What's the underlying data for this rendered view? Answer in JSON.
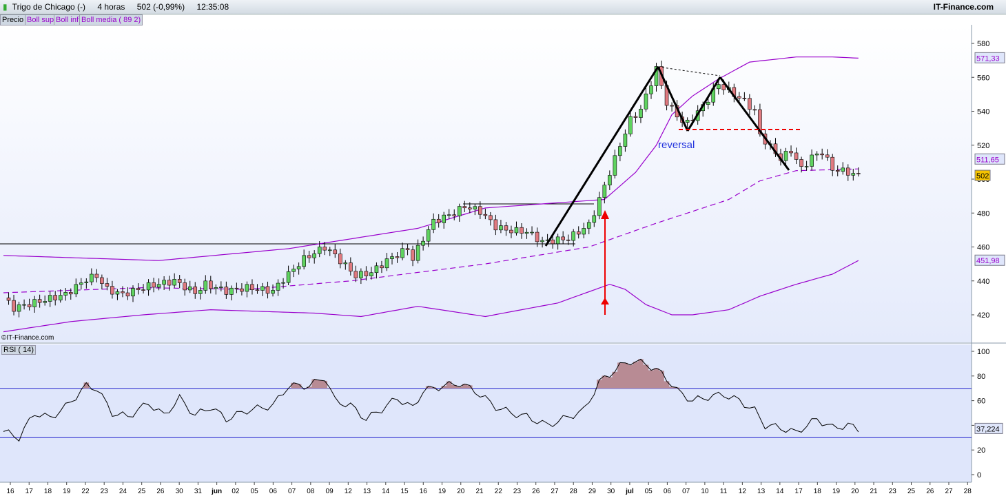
{
  "header": {
    "instrument": "Trigo de Chicago (-)",
    "period": "4 horas",
    "quote": "502 (-0,99%)",
    "time": "12:35:08",
    "brand": "IT-Finance.com"
  },
  "legend": {
    "precio": "Precio",
    "boll_sup": "Boll sup",
    "boll_inf": "Boll inf",
    "boll_media": "Boll media ( 89 2)"
  },
  "watermark": "©IT-Finance.com",
  "annotation": "reversal",
  "rsi_label": "RSI ( 14)",
  "colors": {
    "up": "#5fd35f",
    "down": "#e07a80",
    "boll": "#9900cc",
    "rsi_fill": "#b88b94"
  },
  "chart_data": [
    {
      "type": "candlestick",
      "title": "Trigo de Chicago 4 horas",
      "ylim": [
        410,
        590
      ],
      "yticks": [
        580,
        560,
        540,
        520,
        500,
        480,
        460,
        440,
        420
      ],
      "price_tags": {
        "boll_sup": "571,33",
        "boll_media": "511,65",
        "last": "502",
        "boll_inf": "451,98"
      },
      "x_labels": [
        "16",
        "17",
        "18",
        "19",
        "22",
        "23",
        "24",
        "25",
        "26",
        "30",
        "31",
        "jun",
        "02",
        "05",
        "06",
        "07",
        "08",
        "09",
        "12",
        "13",
        "14",
        "15",
        "16",
        "19",
        "20",
        "21",
        "22",
        "23",
        "26",
        "27",
        "28",
        "29",
        "30",
        "jul",
        "05",
        "06",
        "07",
        "10",
        "11",
        "12",
        "13",
        "14",
        "17",
        "18",
        "19",
        "20",
        "21",
        "23",
        "25",
        "26",
        "27",
        "28"
      ],
      "close_waypoints": [
        [
          0,
          430
        ],
        [
          2,
          424
        ],
        [
          7,
          428
        ],
        [
          12,
          432
        ],
        [
          16,
          441
        ],
        [
          18,
          443
        ],
        [
          20,
          435
        ],
        [
          23,
          432
        ],
        [
          28,
          437
        ],
        [
          33,
          440
        ],
        [
          37,
          433
        ],
        [
          39,
          438
        ],
        [
          43,
          434
        ],
        [
          47,
          436
        ],
        [
          52,
          434
        ],
        [
          54,
          441
        ],
        [
          58,
          453
        ],
        [
          62,
          460
        ],
        [
          64,
          455
        ],
        [
          68,
          443
        ],
        [
          71,
          445
        ],
        [
          74,
          452
        ],
        [
          78,
          459
        ],
        [
          79,
          453
        ],
        [
          81,
          465
        ],
        [
          83,
          475
        ],
        [
          87,
          480
        ],
        [
          89,
          484
        ],
        [
          92,
          481
        ],
        [
          95,
          472
        ],
        [
          97,
          470
        ],
        [
          101,
          469
        ],
        [
          104,
          463
        ],
        [
          109,
          465
        ],
        [
          113,
          473
        ],
        [
          115,
          488
        ],
        [
          117,
          504
        ],
        [
          119,
          520
        ],
        [
          121,
          535
        ],
        [
          123,
          541
        ],
        [
          126,
          565
        ],
        [
          128,
          545
        ],
        [
          131,
          534
        ],
        [
          132,
          533
        ],
        [
          135,
          543
        ],
        [
          138,
          556
        ],
        [
          143,
          546
        ],
        [
          145,
          540
        ],
        [
          146,
          526
        ],
        [
          150,
          512
        ],
        [
          152,
          517
        ],
        [
          154,
          506
        ],
        [
          156,
          513
        ],
        [
          158,
          516
        ],
        [
          160,
          506
        ],
        [
          163,
          504
        ],
        [
          165,
          502
        ]
      ],
      "boll_sup": [
        [
          0,
          455
        ],
        [
          30,
          452
        ],
        [
          55,
          459
        ],
        [
          80,
          471
        ],
        [
          93,
          483
        ],
        [
          116,
          488
        ],
        [
          122,
          504
        ],
        [
          126,
          520
        ],
        [
          129,
          538
        ],
        [
          133,
          549
        ],
        [
          138,
          559
        ],
        [
          144,
          569
        ],
        [
          153,
          572
        ],
        [
          160,
          572
        ],
        [
          165,
          571.3
        ]
      ],
      "boll_inf": [
        [
          0,
          410
        ],
        [
          13,
          416
        ],
        [
          27,
          420
        ],
        [
          40,
          423
        ],
        [
          60,
          421
        ],
        [
          69,
          419
        ],
        [
          80,
          425
        ],
        [
          93,
          419
        ],
        [
          107,
          427
        ],
        [
          117,
          438
        ],
        [
          120,
          435
        ],
        [
          124,
          426
        ],
        [
          129,
          420
        ],
        [
          133,
          420
        ],
        [
          140,
          423
        ],
        [
          146,
          431
        ],
        [
          153,
          438
        ],
        [
          160,
          444
        ],
        [
          165,
          452
        ]
      ],
      "boll_media": [
        [
          0,
          433
        ],
        [
          27,
          436
        ],
        [
          47,
          435
        ],
        [
          67,
          440
        ],
        [
          93,
          450
        ],
        [
          113,
          460
        ],
        [
          126,
          474
        ],
        [
          140,
          488
        ],
        [
          146,
          499
        ],
        [
          153,
          505
        ],
        [
          165,
          506
        ]
      ],
      "annotation_lines": [
        [
          [
            26.8,
            461
          ],
          [
            5.5,
            567
          ]
        ],
        [
          [
            5.5,
            567
          ],
          [
            7.3,
            529
          ]
        ],
        [
          [
            7.3,
            529
          ],
          [
            11.2,
            560
          ]
        ],
        [
          [
            11.2,
            560
          ],
          [
            14.8,
            505
          ]
        ]
      ]
    },
    {
      "type": "line",
      "title": "RSI ( 14)",
      "ylim": [
        0,
        100
      ],
      "yticks": [
        100,
        80,
        60,
        40,
        20,
        0
      ],
      "levels": [
        70,
        30
      ],
      "last": "37,224",
      "values_waypoints": [
        [
          0,
          35
        ],
        [
          3,
          30
        ],
        [
          6,
          50
        ],
        [
          9,
          46
        ],
        [
          12,
          55
        ],
        [
          16,
          72
        ],
        [
          18,
          70
        ],
        [
          21,
          50
        ],
        [
          24,
          47
        ],
        [
          28,
          58
        ],
        [
          31,
          48
        ],
        [
          34,
          62
        ],
        [
          37,
          48
        ],
        [
          40,
          55
        ],
        [
          43,
          45
        ],
        [
          47,
          52
        ],
        [
          52,
          56
        ],
        [
          55,
          72
        ],
        [
          59,
          72
        ],
        [
          62,
          79
        ],
        [
          64,
          60
        ],
        [
          67,
          56
        ],
        [
          70,
          45
        ],
        [
          73,
          53
        ],
        [
          76,
          62
        ],
        [
          79,
          54
        ],
        [
          81,
          68
        ],
        [
          85,
          72
        ],
        [
          88,
          74
        ],
        [
          91,
          68
        ],
        [
          95,
          55
        ],
        [
          98,
          50
        ],
        [
          101,
          47
        ],
        [
          105,
          40
        ],
        [
          108,
          45
        ],
        [
          112,
          52
        ],
        [
          115,
          75
        ],
        [
          119,
          88
        ],
        [
          121,
          92
        ],
        [
          124,
          90
        ],
        [
          127,
          82
        ],
        [
          128,
          78
        ],
        [
          130,
          68
        ],
        [
          133,
          60
        ],
        [
          136,
          63
        ],
        [
          139,
          65
        ],
        [
          142,
          60
        ],
        [
          145,
          52
        ],
        [
          147,
          40
        ],
        [
          150,
          38
        ],
        [
          153,
          34
        ],
        [
          155,
          40
        ],
        [
          157,
          45
        ],
        [
          160,
          38
        ],
        [
          163,
          40
        ],
        [
          165,
          37
        ]
      ]
    }
  ]
}
